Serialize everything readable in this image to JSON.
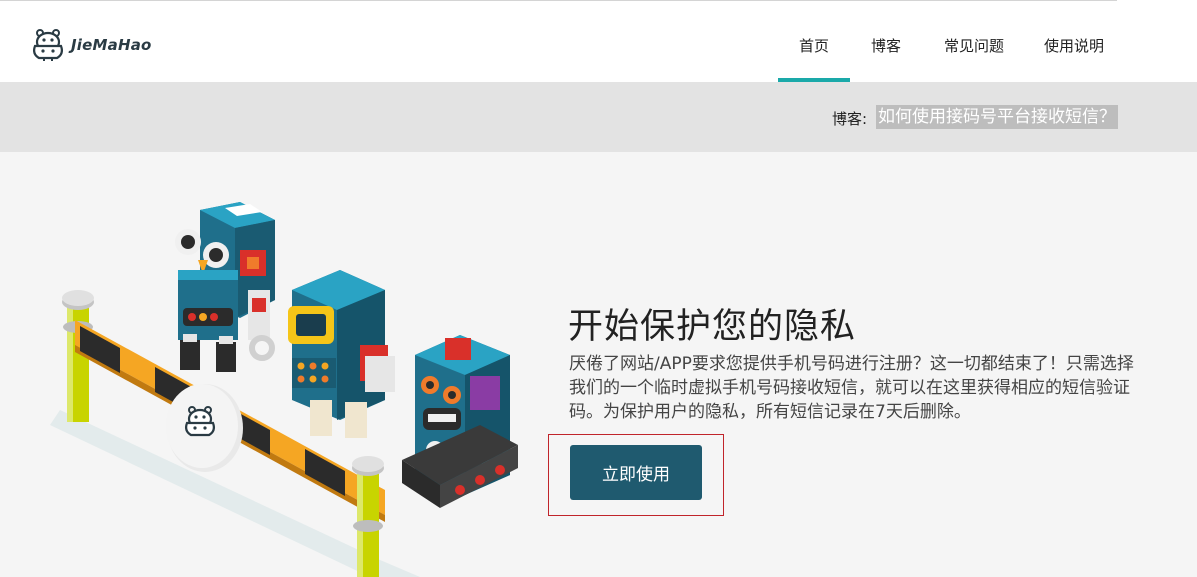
{
  "brand": {
    "name": "JieMaHao"
  },
  "nav": {
    "items": [
      {
        "label": "首页",
        "active": true
      },
      {
        "label": "博客",
        "active": false
      },
      {
        "label": "常见问题",
        "active": false
      },
      {
        "label": "使用说明",
        "active": false
      }
    ]
  },
  "notice": {
    "label": "博客:",
    "link_text": "如何使用接码号平台接收短信？"
  },
  "hero": {
    "title": "开始保护您的隐私",
    "description": "厌倦了网站/APP要求您提供手机号码进行注册？这一切都结束了！只需选择我们的一个临时虚拟手机号码接收短信，就可以在这里获得相应的短信验证码。为保护用户的隐私，所有短信记录在7天后删除。",
    "cta_label": "立即使用"
  },
  "colors": {
    "accent": "#1aa9a9",
    "cta_background": "#1f5a6f",
    "highlight_outline": "#c0242a",
    "notice_background": "#e3e3e3"
  },
  "icons": {
    "logo": "hippo-logo-icon",
    "barrier_badge": "hippo-icon"
  }
}
